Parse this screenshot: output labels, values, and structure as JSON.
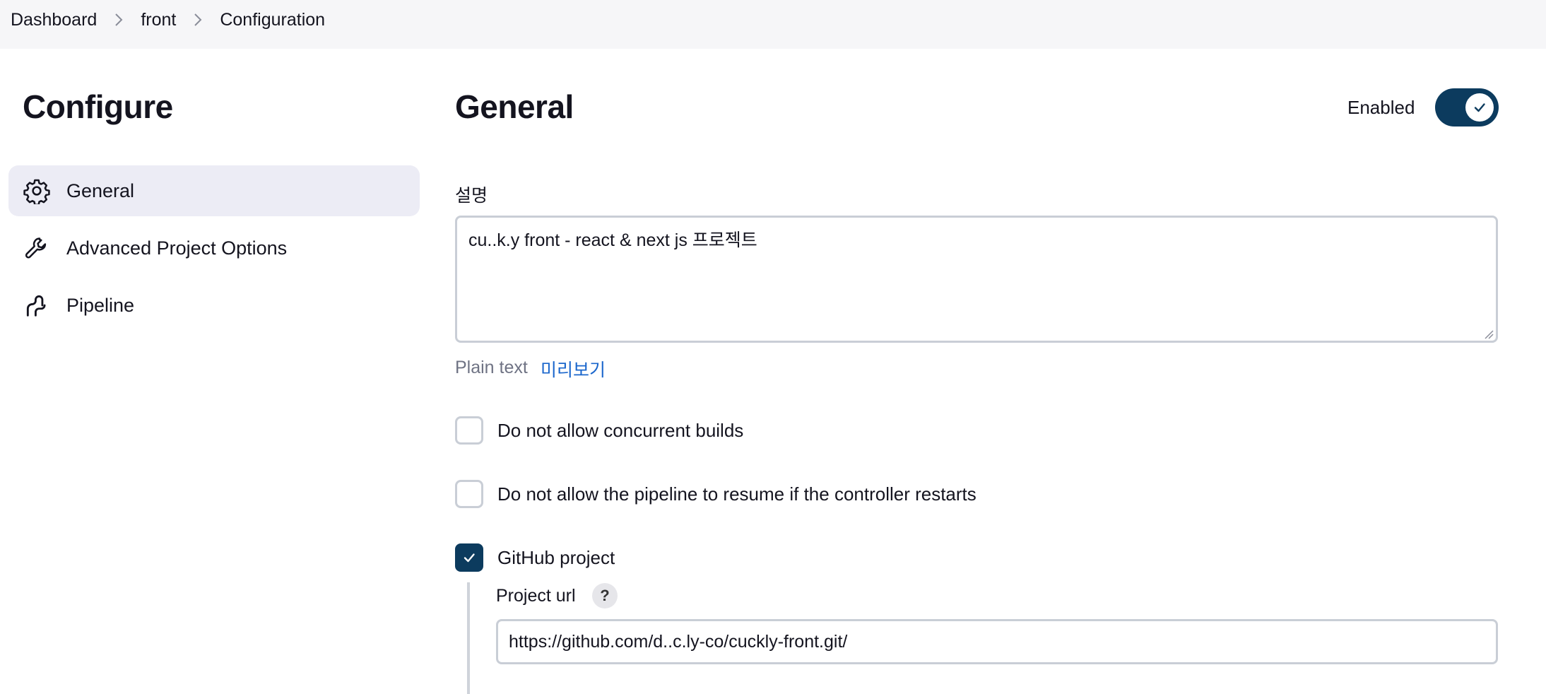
{
  "breadcrumb": {
    "items": [
      "Dashboard",
      "front",
      "Configuration"
    ]
  },
  "sidebar": {
    "title": "Configure",
    "items": [
      {
        "label": "General",
        "icon": "gear-icon",
        "active": true
      },
      {
        "label": "Advanced Project Options",
        "icon": "wrench-icon",
        "active": false
      },
      {
        "label": "Pipeline",
        "icon": "pipeline-icon",
        "active": false
      }
    ]
  },
  "main": {
    "title": "General",
    "enabled_label": "Enabled",
    "enabled": true,
    "description": {
      "label": "설명",
      "value": "cu..k.y front - react & next js 프로젝트",
      "format_label": "Plain text",
      "preview_link": "미리보기"
    },
    "options": [
      {
        "label": "Do not allow concurrent builds",
        "checked": false
      },
      {
        "label": "Do not allow the pipeline to resume if the controller restarts",
        "checked": false
      },
      {
        "label": "GitHub project",
        "checked": true
      }
    ],
    "github": {
      "url_label": "Project url",
      "help": "?",
      "url_value": "https://github.com/d..c.ly-co/cuckly-front.git/"
    }
  },
  "colors": {
    "accent": "#0c3b5e",
    "link": "#1a66cc",
    "topbar_bg": "#f6f6f8",
    "nav_active_bg": "#ececf5",
    "border": "#c9ced6"
  }
}
